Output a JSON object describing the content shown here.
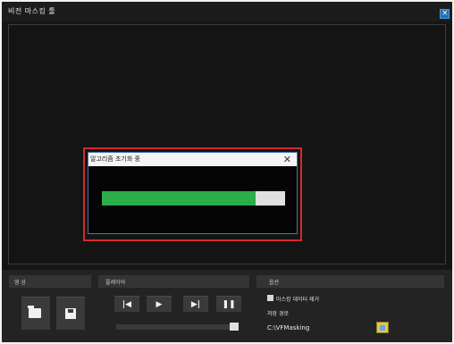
{
  "window": {
    "title": "비전 마스킹 툴"
  },
  "dialog": {
    "title": "알고리즘 초기화 중",
    "close_glyph": "✕",
    "progress_fraction": 0.84
  },
  "panels": {
    "video": {
      "label": "영 상"
    },
    "playback": {
      "label": "플레이어"
    },
    "option": {
      "label": "옵션",
      "remove_label": "마스킹 데이터 제거",
      "path_label": "저장 경로",
      "path_value": "C:\\VFMasking"
    }
  },
  "playback_buttons": {
    "prev": "|◀",
    "play": "▶",
    "next": "▶|",
    "pause": "❚❚"
  },
  "colors": {
    "accent": "#2aae4a",
    "highlight": "#d7282c",
    "titlebar_blue": "#1f6fb2"
  }
}
